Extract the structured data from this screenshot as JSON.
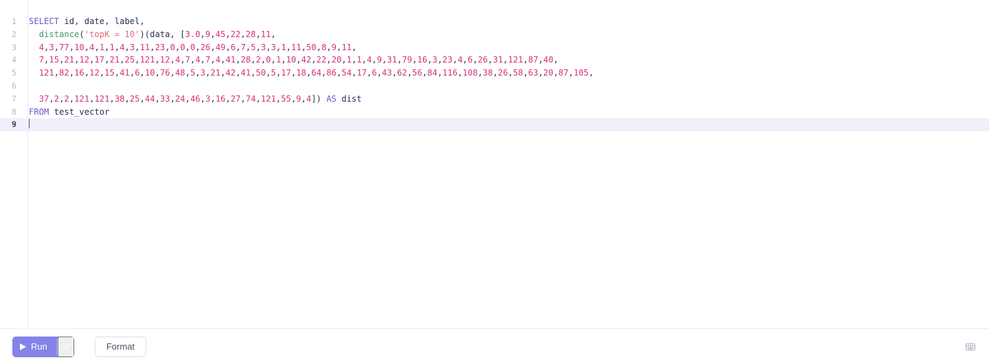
{
  "editor": {
    "language": "sql",
    "active_line": 9,
    "gutter_line_numbers": [
      "1",
      "2",
      "3",
      "4",
      "5",
      "6",
      "7",
      "8",
      "9"
    ],
    "lines": [
      {
        "number": "1",
        "text": "SELECT id, date, label,",
        "tokens": [
          {
            "t": "SELECT",
            "c": "tok-kw"
          },
          {
            "t": " ",
            "c": "tok-plain"
          },
          {
            "t": "id",
            "c": "tok-ident"
          },
          {
            "t": ", ",
            "c": "tok-punct"
          },
          {
            "t": "date",
            "c": "tok-ident"
          },
          {
            "t": ", ",
            "c": "tok-punct"
          },
          {
            "t": "label",
            "c": "tok-ident"
          },
          {
            "t": ",",
            "c": "tok-punct"
          }
        ]
      },
      {
        "number": "2",
        "text": "  distance('topK = 10')(data, [3.0,9,45,22,28,11,",
        "tokens": [
          {
            "t": "  ",
            "c": "tok-plain"
          },
          {
            "t": "distance",
            "c": "tok-fn"
          },
          {
            "t": "(",
            "c": "tok-punct"
          },
          {
            "t": "'topK = 10'",
            "c": "tok-str"
          },
          {
            "t": ")(",
            "c": "tok-punct"
          },
          {
            "t": "data",
            "c": "tok-ident"
          },
          {
            "t": ", [",
            "c": "tok-punct"
          },
          {
            "t": "3.0",
            "c": "tok-num"
          },
          {
            "t": ",",
            "c": "tok-punct"
          },
          {
            "t": "9",
            "c": "tok-num"
          },
          {
            "t": ",",
            "c": "tok-punct"
          },
          {
            "t": "45",
            "c": "tok-num"
          },
          {
            "t": ",",
            "c": "tok-punct"
          },
          {
            "t": "22",
            "c": "tok-num"
          },
          {
            "t": ",",
            "c": "tok-punct"
          },
          {
            "t": "28",
            "c": "tok-num"
          },
          {
            "t": ",",
            "c": "tok-punct"
          },
          {
            "t": "11",
            "c": "tok-num"
          },
          {
            "t": ",",
            "c": "tok-punct"
          }
        ]
      },
      {
        "number": "3",
        "text": "  4,3,77,10,4,1,1,4,3,11,23,0,0,0,26,49,6,7,5,3,3,1,11,50,8,9,11,",
        "numbers": [
          4,
          3,
          77,
          10,
          4,
          1,
          1,
          4,
          3,
          11,
          23,
          0,
          0,
          0,
          26,
          49,
          6,
          7,
          5,
          3,
          3,
          1,
          11,
          50,
          8,
          9,
          11
        ],
        "trailing": ","
      },
      {
        "number": "4",
        "text": "  7,15,21,12,17,21,25,121,12,4,7,4,7,4,41,28,2,0,1,10,42,22,20,1,1,4,9,31,79,16,3,23,4,6,26,31,121,87,40,",
        "numbers": [
          7,
          15,
          21,
          12,
          17,
          21,
          25,
          121,
          12,
          4,
          7,
          4,
          7,
          4,
          41,
          28,
          2,
          0,
          1,
          10,
          42,
          22,
          20,
          1,
          1,
          4,
          9,
          31,
          79,
          16,
          3,
          23,
          4,
          6,
          26,
          31,
          121,
          87,
          40
        ],
        "trailing": ","
      },
      {
        "number": "5",
        "text": "  121,82,16,12,15,41,6,10,76,48,5,3,21,42,41,50,5,17,18,64,86,54,17,6,43,62,56,84,116,108,38,26,58,63,20,87,105,",
        "numbers": [
          121,
          82,
          16,
          12,
          15,
          41,
          6,
          10,
          76,
          48,
          5,
          3,
          21,
          42,
          41,
          50,
          5,
          17,
          18,
          64,
          86,
          54,
          17,
          6,
          43,
          62,
          56,
          84,
          116,
          108,
          38,
          26,
          58,
          63,
          20,
          87,
          105
        ],
        "trailing": ","
      },
      {
        "number": "6",
        "text": ""
      },
      {
        "number": "7",
        "text": "  37,2,2,121,121,38,25,44,33,24,46,3,16,27,74,121,55,9,4]) AS dist",
        "numbers": [
          37,
          2,
          2,
          121,
          121,
          38,
          25,
          44,
          33,
          24,
          46,
          3,
          16,
          27,
          74,
          121,
          55,
          9,
          4
        ],
        "trailing": "]) ",
        "keyword": "AS",
        "alias": "dist"
      },
      {
        "number": "8",
        "text": "FROM test_vector",
        "tokens": [
          {
            "t": "FROM",
            "c": "tok-kw"
          },
          {
            "t": " ",
            "c": "tok-plain"
          },
          {
            "t": "test_vector",
            "c": "tok-ident"
          }
        ]
      },
      {
        "number": "9",
        "text": ""
      }
    ]
  },
  "toolbar": {
    "run_label": "Run",
    "run_dropdown_icon": "chevron-down-icon",
    "run_play_icon": "play-icon",
    "format_label": "Format",
    "keyboard_shortcuts_icon": "keyboard-icon"
  },
  "colors": {
    "accent": "#8583e8",
    "keyword": "#6b57c8",
    "function": "#3f9a63",
    "string": "#e06b7a",
    "number": "#d6327d",
    "identifier": "#2b2b57",
    "active_line_bg": "#f0f0fb",
    "gutter_text": "#b9b9c6",
    "toolbar_border": "#ebebf2"
  }
}
